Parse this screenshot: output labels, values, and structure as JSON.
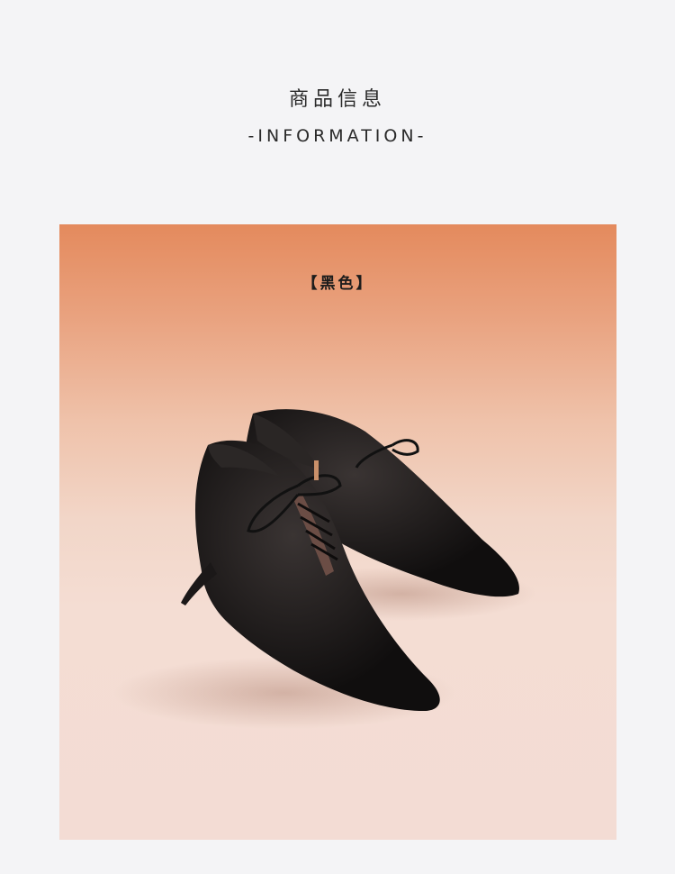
{
  "header": {
    "title_cn": "商品信息",
    "title_en": "-INFORMATION-"
  },
  "product_photo": {
    "color_label": "【黑色】",
    "subject": "black pointed-toe lace-up stiletto ankle boots"
  },
  "colors": {
    "page_bg": "#f4f4f6",
    "backdrop_top": "#e48a5d",
    "backdrop_bottom": "#f3dcd4",
    "shoe": "#141212",
    "heel_accent": "#c9906a"
  }
}
